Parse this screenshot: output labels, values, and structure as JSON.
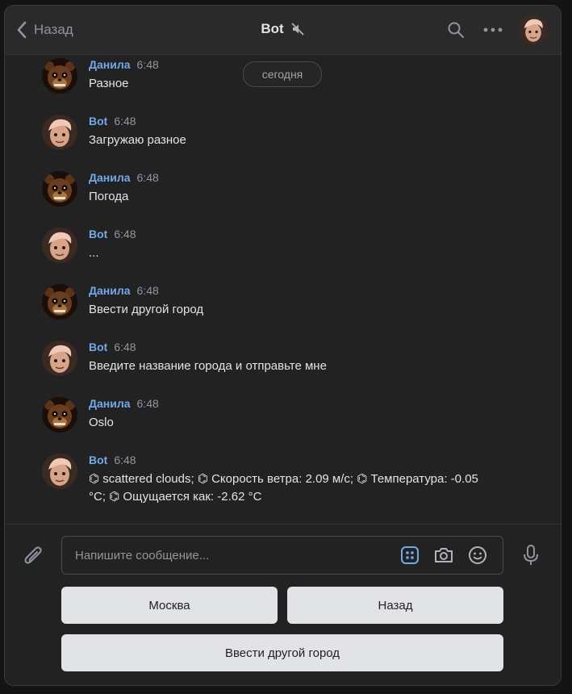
{
  "header": {
    "back_label": "Назад",
    "title": "Bot",
    "icons": [
      "chevron-left-icon",
      "mute-icon",
      "search-icon",
      "more-icon"
    ]
  },
  "date_separator": "сегодня",
  "messages": [
    {
      "sender": "Данила",
      "time": "6:48",
      "text": "Разное",
      "avatar": "freddy"
    },
    {
      "sender": "Bot",
      "time": "6:48",
      "text": "Загружаю разное",
      "avatar": "bot"
    },
    {
      "sender": "Данила",
      "time": "6:48",
      "text": "Погода",
      "avatar": "freddy"
    },
    {
      "sender": "Bot",
      "time": "6:48",
      "text": "...",
      "avatar": "bot"
    },
    {
      "sender": "Данила",
      "time": "6:48",
      "text": "Ввести другой город",
      "avatar": "freddy"
    },
    {
      "sender": "Bot",
      "time": "6:48",
      "text": "Введите название города и отправьте мне",
      "avatar": "bot"
    },
    {
      "sender": "Данила",
      "time": "6:48",
      "text": "Oslo",
      "avatar": "freddy"
    },
    {
      "sender": "Bot",
      "time": "6:48",
      "text": "⌬ scattered clouds; ⌬ Скорость ветра: 2.09 м/с; ⌬ Температура: -0.05 °C; ⌬ Ощущается как: -2.62 °C",
      "avatar": "bot"
    }
  ],
  "composer": {
    "placeholder": "Напишите сообщение...",
    "icons": [
      "attach-icon",
      "keyboard-icon",
      "camera-icon",
      "emoji-icon",
      "microphone-icon"
    ]
  },
  "keyboard": {
    "buttons": [
      "Москва",
      "Назад",
      "Ввести другой город"
    ]
  },
  "colors": {
    "background": "#222222",
    "header": "#2a2a2a",
    "accent": "#71aaeb",
    "button": "#e1e3e6"
  }
}
